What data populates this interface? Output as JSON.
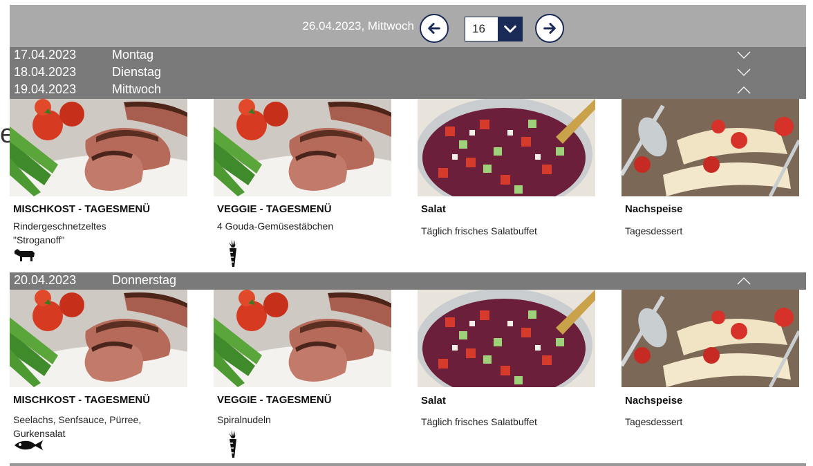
{
  "header": {
    "current_date": "26.04.2023, Mittwoch",
    "week_value": "16",
    "prev_icon": "arrow-left-icon",
    "next_icon": "arrow-right-icon"
  },
  "days": [
    {
      "date": "17.04.2023",
      "weekday": "Montag",
      "expanded": false
    },
    {
      "date": "18.04.2023",
      "weekday": "Dienstag",
      "expanded": false
    },
    {
      "date": "19.04.2023",
      "weekday": "Mittwoch",
      "expanded": true,
      "menus": [
        {
          "title": "MISCHKOST - TAGESMENÜ",
          "desc": "Rindergeschnetzeltes \"Stroganoff\"",
          "icon": "cow-icon"
        },
        {
          "title": "VEGGIE - TAGESMENÜ",
          "desc": "4 Gouda-Gemüsestäbchen",
          "icon": "carrot-icon"
        },
        {
          "title": "Salat",
          "desc": "Täglich frisches Salatbuffet",
          "icon": ""
        },
        {
          "title": "Nachspeise",
          "desc": "Tagesdessert",
          "icon": ""
        }
      ]
    },
    {
      "date": "20.04.2023",
      "weekday": "Donnerstag",
      "expanded": true,
      "menus": [
        {
          "title": "MISCHKOST - TAGESMENÜ",
          "desc": "Seelachs, Senfsauce, Pürree, Gurkensalat",
          "icon": "fish-icon"
        },
        {
          "title": "VEGGIE - TAGESMENÜ",
          "desc": "Spiralnudeln",
          "icon": "carrot-icon"
        },
        {
          "title": "Salat",
          "desc": "Täglich frisches Salatbuffet",
          "icon": ""
        },
        {
          "title": "Nachspeise",
          "desc": "Tagesdessert",
          "icon": ""
        }
      ]
    }
  ],
  "colors": {
    "header_bg": "#aaaaaa",
    "day_bar_bg": "#7a7a7a",
    "accent_navy": "#1a2a57"
  }
}
